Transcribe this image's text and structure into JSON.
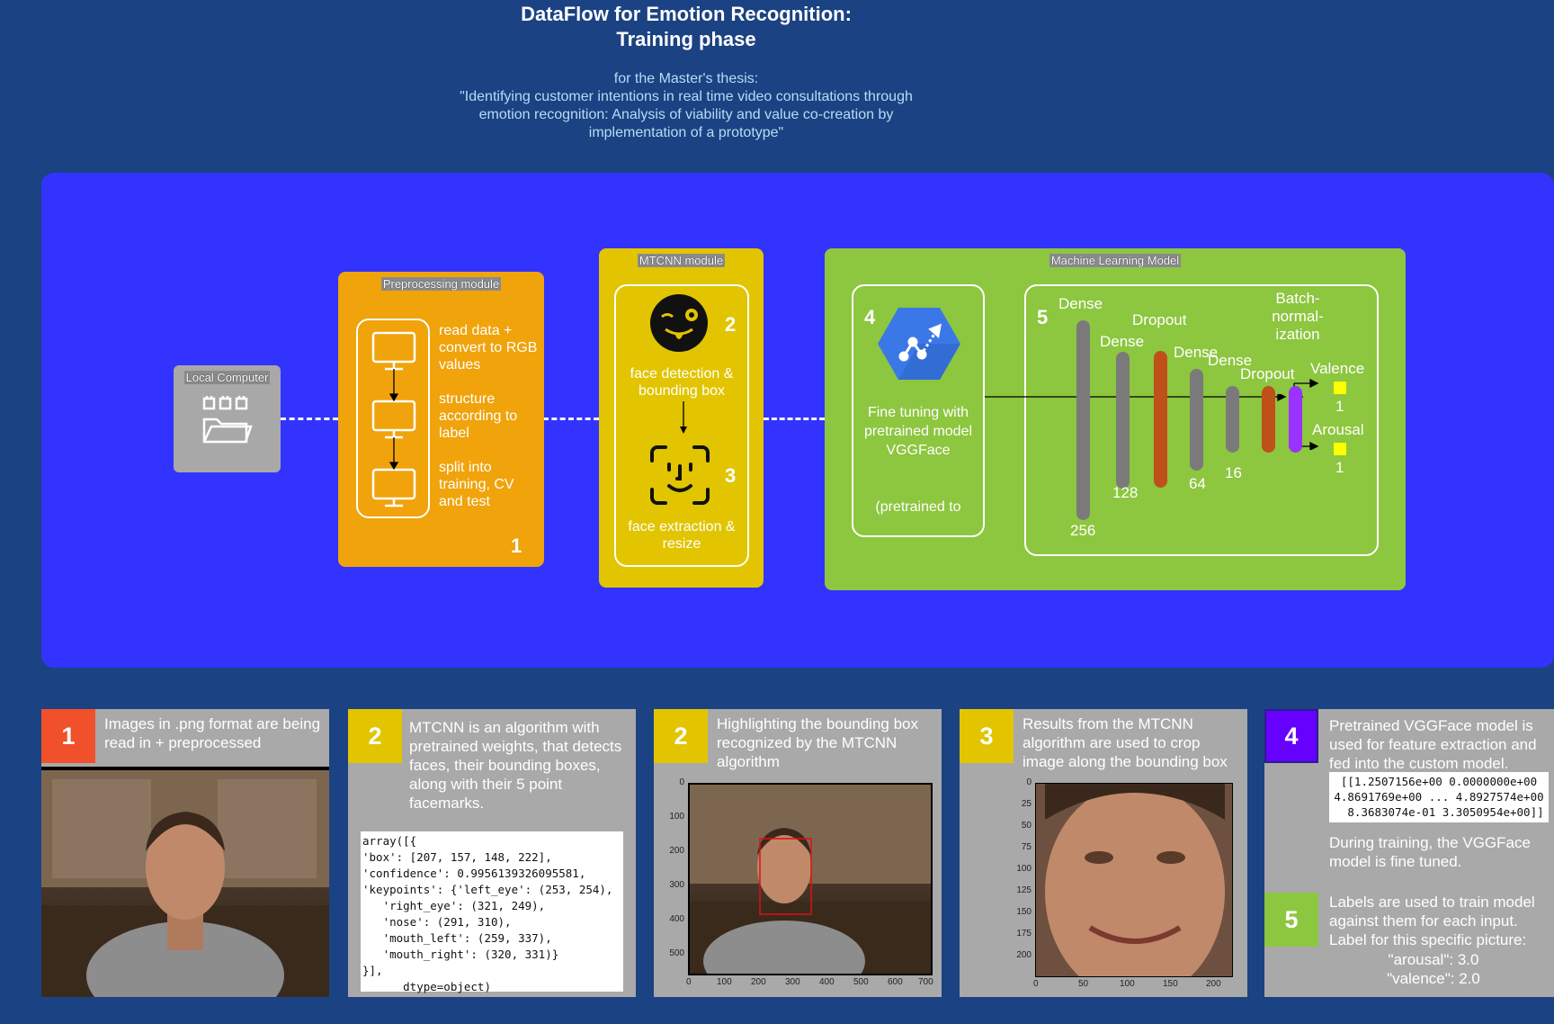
{
  "header": {
    "title_line1": "DataFlow for Emotion Recognition:",
    "title_line2": "Training phase",
    "sub_line1": "for the Master's thesis:",
    "sub_line2": "\"Identifying customer intentions in real time video consultations through",
    "sub_line3": "emotion recognition: Analysis of viability and value co-creation by",
    "sub_line4": "implementation of a prototype\""
  },
  "diagram": {
    "local_computer": "Local Computer",
    "preprocessing": {
      "label": "Preprocessing module",
      "step1": "read data + convert to RGB values",
      "step2": "structure according to label",
      "step3": "split into training, CV and test",
      "number": "1"
    },
    "mtcnn": {
      "label": "MTCNN module",
      "num2": "2",
      "detection": "face detection & bounding box",
      "num3": "3",
      "extraction": "face extraction & resize"
    },
    "ml": {
      "label": "Machine Learning Model",
      "num4": "4",
      "finetune": "Fine tuning with pretrained model VGGFace",
      "finetune2": "(pretrained to",
      "num5": "5",
      "layers": [
        {
          "name": "Dense",
          "size": "256"
        },
        {
          "name": "Dense",
          "size": "128"
        },
        {
          "name": "Dropout",
          "size": ""
        },
        {
          "name": "Dense",
          "size": "64"
        },
        {
          "name": "Dense",
          "size": "16"
        },
        {
          "name": "Dropout",
          "size": ""
        },
        {
          "name": "Batch-normal-ization",
          "size": ""
        }
      ],
      "batch_l1": "Batch-",
      "batch_l2": "normal-",
      "batch_l3": "ization",
      "valence": "Valence",
      "valence_out": "1",
      "arousal": "Arousal",
      "arousal_out": "1"
    },
    "colors": {
      "dense": "#7a7a7a",
      "dropout": "#c0501a",
      "batchnorm": "#9933ff",
      "output": "#ffff00"
    }
  },
  "cards": {
    "c1": {
      "num": "1",
      "color": "#f0502a",
      "text": "Images in .png format are being read in + preprocessed"
    },
    "c2": {
      "num": "2",
      "color": "#e2c400",
      "text": "MTCNN is an algorithm with pretrained weights, that detects faces, their bounding boxes, along with their 5 point facemarks.",
      "code": "array([{\n'box': [207, 157, 148, 222],\n'confidence': 0.9956139326095581,\n'keypoints': {'left_eye': (253, 254),\n   'right_eye': (321, 249),\n   'nose': (291, 310),\n   'mouth_left': (259, 337),\n   'mouth_right': (320, 331)}\n}],\n      dtype=object)"
    },
    "c3": {
      "num": "2",
      "color": "#e2c400",
      "text": "Highlighting the bounding box recognized by the MTCNN algorithm",
      "yticks": [
        "0",
        "100",
        "200",
        "300",
        "400",
        "500"
      ],
      "xticks": [
        "0",
        "100",
        "200",
        "300",
        "400",
        "500",
        "600",
        "700"
      ]
    },
    "c4": {
      "num": "3",
      "color": "#e2c400",
      "text": "Results from the MTCNN algorithm are used to crop image along the bounding box",
      "yticks": [
        "0",
        "25",
        "50",
        "75",
        "100",
        "125",
        "150",
        "175",
        "200"
      ],
      "xticks": [
        "0",
        "50",
        "100",
        "150",
        "200"
      ]
    },
    "c5": {
      "num4": "4",
      "color4": "#6600ff",
      "text4": "Pretrained VGGFace model is used for feature extraction and fed into the custom model.",
      "code4": "[[1.2507156e+00 0.0000000e+00\n4.8691769e+00 ... 4.8927574e+00\n  8.3683074e-01 3.3050954e+00]]",
      "text4b": "During training, the VGGFace model is fine tuned.",
      "num5": "5",
      "color5": "#8dc63f",
      "text5": "Labels are used to train model against them for each input. Label for this specific picture:",
      "label_arousal": "\"arousal\": 3.0",
      "label_valence": "\"valence\": 2.0"
    }
  }
}
